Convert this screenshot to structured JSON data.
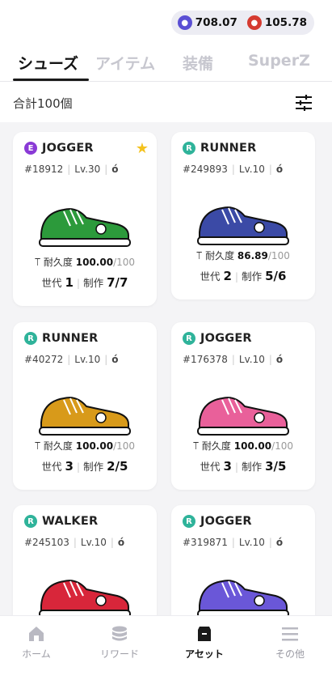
{
  "header": {
    "balances": [
      {
        "icon": "blue-token-icon",
        "value": "708.07"
      },
      {
        "icon": "red-token-icon",
        "value": "105.78"
      }
    ]
  },
  "tabs": [
    "シューズ",
    "アイテム",
    "装備",
    "SuperZ"
  ],
  "count_label": "合計100個",
  "labels": {
    "durability": "耐久度",
    "generation": "世代",
    "crafted": "制作"
  },
  "cards": [
    {
      "rarity": "E",
      "type": "JOGGER",
      "favorite": true,
      "id": "#18912",
      "level": "Lv.30",
      "durability": "100.00",
      "durability_max": "/100",
      "generation": "1",
      "crafted": "7/7",
      "color": "#2c9a3b"
    },
    {
      "rarity": "R",
      "type": "RUNNER",
      "favorite": false,
      "id": "#249893",
      "level": "Lv.10",
      "durability": "86.89",
      "durability_max": "/100",
      "generation": "2",
      "crafted": "5/6",
      "color": "#3b4aa6"
    },
    {
      "rarity": "R",
      "type": "RUNNER",
      "favorite": false,
      "id": "#40272",
      "level": "Lv.10",
      "durability": "100.00",
      "durability_max": "/100",
      "generation": "3",
      "crafted": "2/5",
      "color": "#d89a1a"
    },
    {
      "rarity": "R",
      "type": "JOGGER",
      "favorite": false,
      "id": "#176378",
      "level": "Lv.10",
      "durability": "100.00",
      "durability_max": "/100",
      "generation": "3",
      "crafted": "3/5",
      "color": "#e9609a"
    },
    {
      "rarity": "R",
      "type": "WALKER",
      "favorite": false,
      "id": "#245103",
      "level": "Lv.10",
      "color": "#d8263a"
    },
    {
      "rarity": "R",
      "type": "JOGGER",
      "favorite": false,
      "id": "#319871",
      "level": "Lv.10",
      "color": "#6a57d8"
    }
  ],
  "nav": [
    {
      "label": "ホーム",
      "icon": "home-icon",
      "active": false
    },
    {
      "label": "リワード",
      "icon": "coins-icon",
      "active": false
    },
    {
      "label": "アセット",
      "icon": "box-icon",
      "active": true
    },
    {
      "label": "その他",
      "icon": "menu-icon",
      "active": false
    }
  ]
}
